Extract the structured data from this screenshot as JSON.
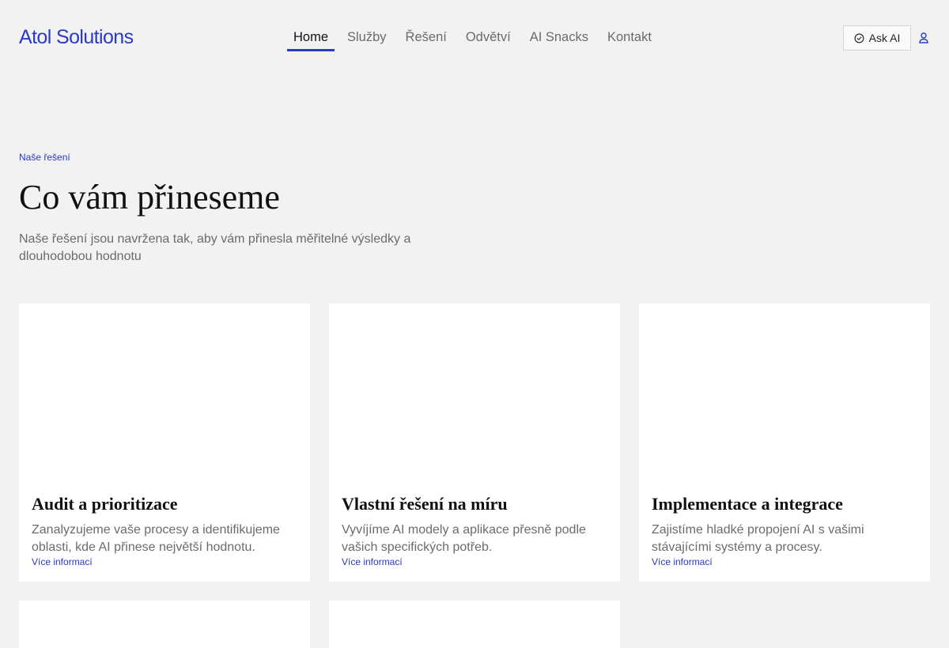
{
  "header": {
    "logo": "Atol Solutions",
    "nav": [
      {
        "label": "Home",
        "active": true
      },
      {
        "label": "Služby",
        "active": false
      },
      {
        "label": "Řešení",
        "active": false
      },
      {
        "label": "Odvětví",
        "active": false
      },
      {
        "label": "AI Snacks",
        "active": false
      },
      {
        "label": "Kontakt",
        "active": false
      }
    ],
    "ask_ai_label": "Ask AI",
    "ask_ai_icon": "check-circle-icon",
    "user_icon": "user-icon"
  },
  "hero": {
    "eyebrow": "Naše řešení",
    "title": "Co vám přineseme",
    "subtitle": "Naše řešení jsou navržena tak, aby vám přinesla měřitelné výsledky a dlouhodobou hodnotu"
  },
  "cards": [
    {
      "title": "Audit a prioritizace",
      "description": "Zanalyzujeme vaše procesy a identifikujeme oblasti, kde AI přinese největší hodnotu.",
      "link": "Více informací"
    },
    {
      "title": "Vlastní řešení na míru",
      "description": "Vyvíjíme AI modely a aplikace přesně podle vašich specifických potřeb.",
      "link": "Více informací"
    },
    {
      "title": "Implementace a integrace",
      "description": "Zajistíme hladké propojení AI s vašimi stávajícími systémy a procesy.",
      "link": "Více informací"
    }
  ],
  "colors": {
    "accent": "#2a39c9",
    "background": "#f2f2f2",
    "card": "#ffffff",
    "muted_text": "#6b6b6b"
  }
}
